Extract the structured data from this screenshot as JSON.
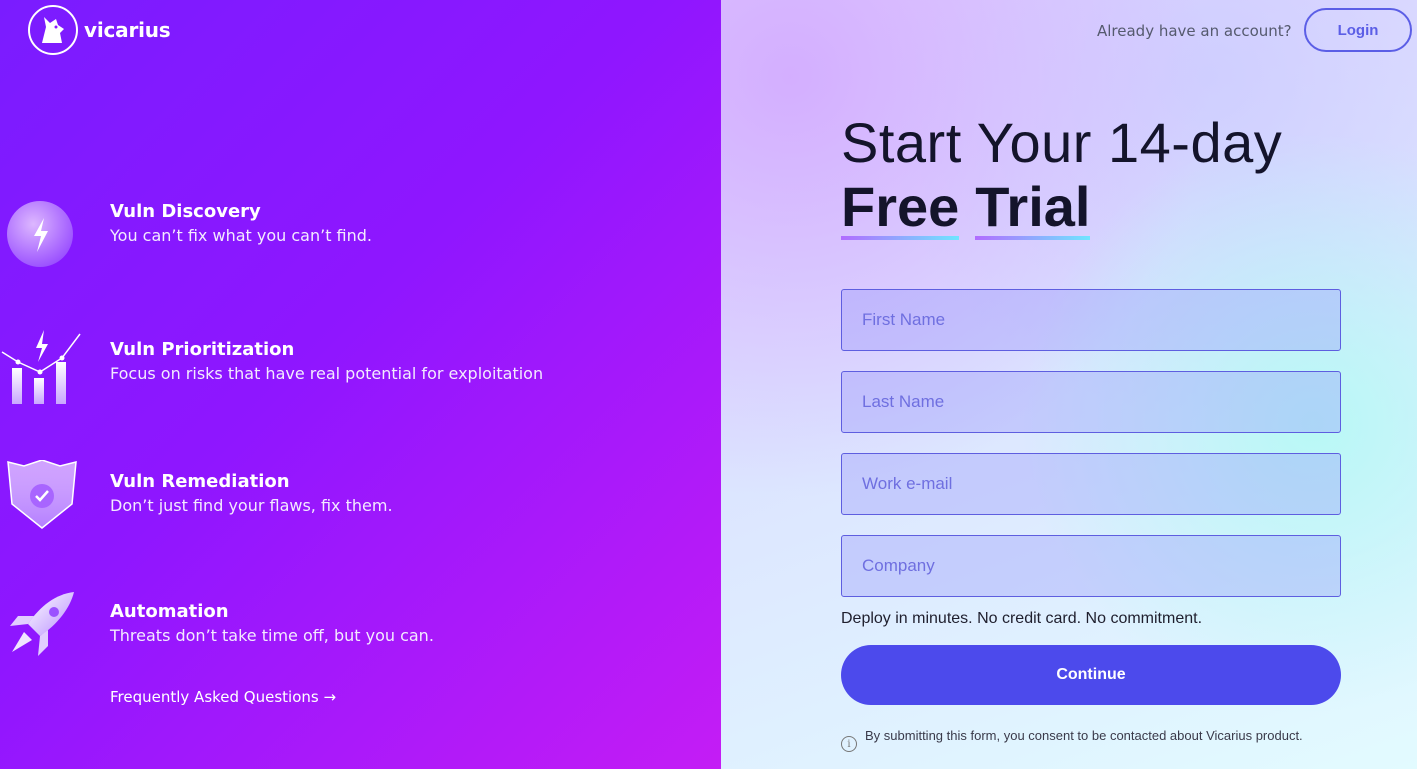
{
  "brand": {
    "name": "vicarius"
  },
  "features": [
    {
      "title": "Vuln Discovery",
      "desc": "You can’t fix what you can’t find.",
      "icon": "lightning-orb-icon"
    },
    {
      "title": "Vuln Prioritization",
      "desc": "Focus on risks that have real potential for exploitation",
      "icon": "bar-chart-icon"
    },
    {
      "title": "Vuln Remediation",
      "desc": "Don’t just find your flaws, fix them.",
      "icon": "shield-check-icon"
    },
    {
      "title": "Automation",
      "desc": "Threats don’t take time off, but you can.",
      "icon": "rocket-icon"
    }
  ],
  "faq": {
    "label": "Frequently Asked Questions →"
  },
  "header": {
    "have_account": "Already have an account?",
    "login_label": "Login"
  },
  "headline": {
    "line1": "Start Your 14-day",
    "word1": "Free",
    "word2": "Trial"
  },
  "form": {
    "first_name_placeholder": "First Name",
    "last_name_placeholder": "Last Name",
    "email_placeholder": "Work e-mail",
    "company_placeholder": "Company",
    "deploy_note": "Deploy in minutes. No credit card. No commitment.",
    "continue_label": "Continue",
    "consent": "By submitting this form, you consent to be contacted about Vicarius product."
  },
  "colors": {
    "accent": "#4c4aec",
    "left_panel_start": "#7a1cff",
    "left_panel_end": "#c41cf5"
  }
}
